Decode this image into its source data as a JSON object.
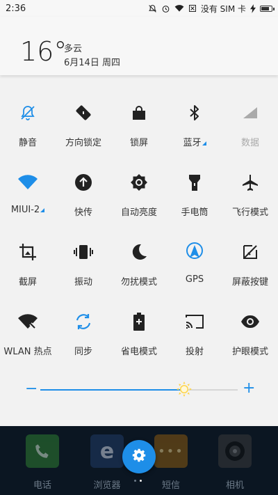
{
  "status_bar": {
    "time": "2:36",
    "carrier": "没有 SIM 卡"
  },
  "weather": {
    "temperature": "16°",
    "condition": "多云",
    "date": "6月14日 周四"
  },
  "toggles": [
    {
      "label": "静音",
      "icon": "bell-muted-icon",
      "active": true
    },
    {
      "label": "方向锁定",
      "icon": "rotation-lock-icon",
      "active": false
    },
    {
      "label": "锁屏",
      "icon": "lock-bag-icon",
      "active": false
    },
    {
      "label": "蓝牙",
      "icon": "bluetooth-icon",
      "active": false,
      "has_more": true
    },
    {
      "label": "数据",
      "icon": "signal-icon",
      "active": false,
      "disabled": true
    },
    {
      "label": "MIUI-2",
      "icon": "wifi-icon",
      "active": true,
      "has_more": true
    },
    {
      "label": "快传",
      "icon": "upload-icon",
      "active": false
    },
    {
      "label": "自动亮度",
      "icon": "auto-brightness-icon",
      "active": false
    },
    {
      "label": "手电筒",
      "icon": "flashlight-icon",
      "active": false
    },
    {
      "label": "飞行模式",
      "icon": "airplane-icon",
      "active": false
    },
    {
      "label": "截屏",
      "icon": "screenshot-icon",
      "active": false
    },
    {
      "label": "振动",
      "icon": "vibrate-icon",
      "active": false
    },
    {
      "label": "勿扰模式",
      "icon": "moon-icon",
      "active": false
    },
    {
      "label": "GPS",
      "icon": "gps-icon",
      "active": true
    },
    {
      "label": "屏蔽按键",
      "icon": "block-keys-icon",
      "active": false
    },
    {
      "label": "WLAN 热点",
      "icon": "hotspot-icon",
      "active": false
    },
    {
      "label": "同步",
      "icon": "sync-icon",
      "active": true
    },
    {
      "label": "省电模式",
      "icon": "battery-saver-icon",
      "active": false
    },
    {
      "label": "投射",
      "icon": "cast-icon",
      "active": false
    },
    {
      "label": "护眼模式",
      "icon": "eye-icon",
      "active": false
    }
  ],
  "brightness": {
    "minus": "−",
    "plus": "+",
    "level": 0.73
  },
  "dock": {
    "apps": [
      {
        "name": "电话",
        "icon": "phone-icon"
      },
      {
        "name": "浏览器",
        "icon": "browser-icon"
      },
      {
        "name": "短信",
        "icon": "message-icon"
      },
      {
        "name": "相机",
        "icon": "camera-icon"
      }
    ],
    "settings_icon": "gear-icon"
  },
  "colors": {
    "accent": "#1e8ee8",
    "icon": "#222222",
    "disabled": "#aaaaaa"
  }
}
